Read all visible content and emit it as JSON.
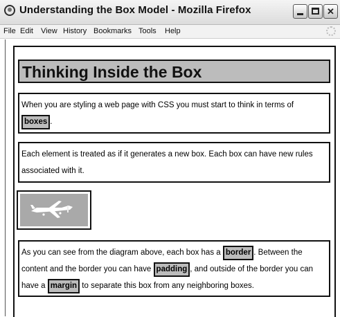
{
  "window": {
    "title": "Understanding the Box Model - Mozilla Firefox"
  },
  "menubar": {
    "items": [
      "File",
      "Edit",
      "View",
      "History",
      "Bookmarks",
      "Tools",
      "Help"
    ]
  },
  "page": {
    "heading": "Thinking Inside the Box",
    "para1": {
      "text": "When you are styling a web page with CSS you must start to think in terms of",
      "tag": "boxes",
      "after": "."
    },
    "para2": {
      "text": "Each element is treated as if it generates a new box. Each box can have new rules associated with it."
    },
    "image": {
      "icon": "airplane-icon"
    },
    "para3": {
      "t1": "As you can see from the diagram above, each box has a",
      "tag1": "border",
      "t2": ". Between the content and the border you can have",
      "tag2": "padding",
      "t3": ", and outside of the border you can have a",
      "tag3": "margin",
      "t4": "to separate this box from any neighboring boxes."
    }
  },
  "colors": {
    "highlight_gray": "#bcbcbc",
    "border": "#111111"
  }
}
